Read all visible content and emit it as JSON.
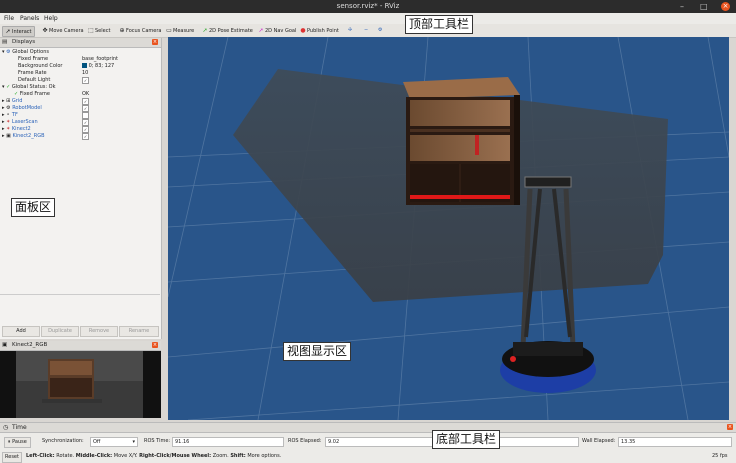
{
  "window": {
    "title": "sensor.rviz* - RViz"
  },
  "menu": {
    "file": "File",
    "panels": "Panels",
    "help": "Help"
  },
  "toolbar": {
    "interact": "Interact",
    "move_camera": "Move Camera",
    "select": "Select",
    "focus_camera": "Focus Camera",
    "measure": "Measure",
    "pose_estimate": "2D Pose Estimate",
    "nav_goal": "2D Nav Goal",
    "publish_point": "Publish Point"
  },
  "displays": {
    "title": "Displays",
    "global_options": "Global Options",
    "fixed_frame_label": "Fixed Frame",
    "fixed_frame_value": "base_footprint",
    "bg_color_label": "Background Color",
    "bg_color_value": "0; 83; 127",
    "frame_rate_label": "Frame Rate",
    "frame_rate_value": "10",
    "default_light_label": "Default Light",
    "global_status": "Global Status: Ok",
    "status_fixed_frame_label": "Fixed Frame",
    "status_fixed_frame_value": "OK",
    "items": [
      {
        "name": "Grid",
        "checked": true
      },
      {
        "name": "RobotModel",
        "checked": true
      },
      {
        "name": "TF",
        "checked": false
      },
      {
        "name": "LaserScan",
        "checked": true
      },
      {
        "name": "Kinect2",
        "checked": true
      },
      {
        "name": "Kinect2_RGB",
        "checked": true
      }
    ],
    "buttons": {
      "add": "Add",
      "duplicate": "Duplicate",
      "remove": "Remove",
      "rename": "Rename"
    }
  },
  "kinect_panel": {
    "title": "Kinect2_RGB"
  },
  "time": {
    "title": "Time",
    "pause": "Pause",
    "sync_label": "Synchronization:",
    "sync_value": "Off",
    "ros_time_label": "ROS Time:",
    "ros_time_value": "91.16",
    "ros_elapsed_label": "ROS Elapsed:",
    "ros_elapsed_value": "9.02",
    "wall_elapsed_label": "Wall Elapsed:",
    "wall_elapsed_value": "13.35"
  },
  "status": {
    "reset": "Reset",
    "hint_b1": "Left-Click:",
    "hint_t1": " Rotate. ",
    "hint_b2": "Middle-Click:",
    "hint_t2": " Move X/Y. ",
    "hint_b3": "Right-Click/Mouse Wheel:",
    "hint_t3": " Zoom. ",
    "hint_b4": "Shift:",
    "hint_t4": " More options.",
    "fps": "25 fps"
  },
  "annotations": {
    "top": "顶部工具栏",
    "panel": "面板区",
    "view": "视图显示区",
    "bottom": "底部工具栏"
  },
  "colors": {
    "viewport_bg": "#29558a",
    "accent": "#e9541f",
    "selection": "#3d7fc6"
  }
}
